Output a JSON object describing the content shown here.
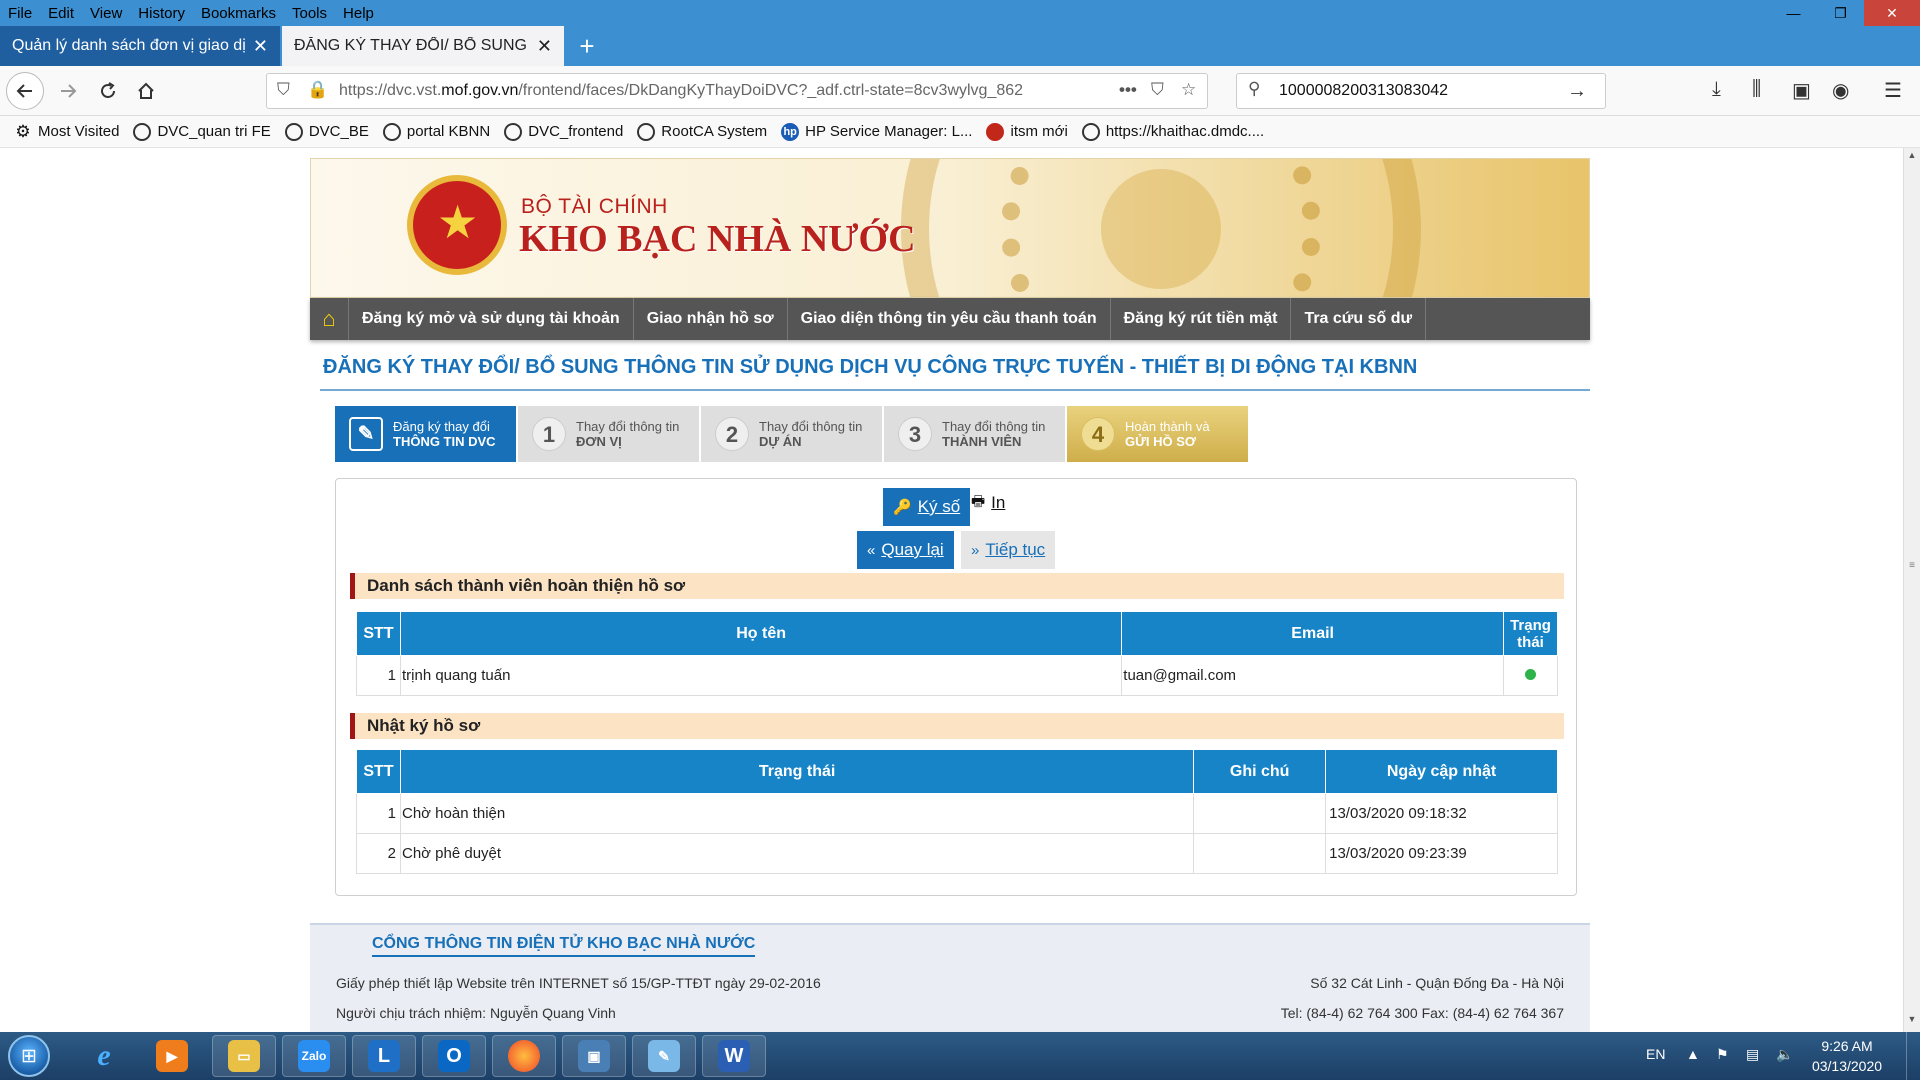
{
  "browser": {
    "menu": [
      "File",
      "Edit",
      "View",
      "History",
      "Bookmarks",
      "Tools",
      "Help"
    ],
    "window_buttons": {
      "minimize": "—",
      "restore": "❐",
      "close": "✕"
    },
    "tabs": [
      {
        "label": "Quản lý danh sách đơn vị giao dịch",
        "close": "✕"
      },
      {
        "label": "ĐĂNG KÝ THAY ĐỔI/ BỔ SUNG DỊCH",
        "close": "✕"
      }
    ],
    "new_tab": "+",
    "url_prefix": "https://dvc.vst.",
    "url_domain": "mof.gov.vn",
    "url_suffix": "/frontend/faces/DkDangKyThayDoiDVC?_adf.ctrl-state=8cv3wylvg_862",
    "url_more": "•••",
    "search_value": "1000008200313083042",
    "search_go": "→",
    "bookmarks": [
      {
        "label": "Most Visited",
        "icon": "gear-icon"
      },
      {
        "label": "DVC_quan tri FE",
        "icon": "globe-icon"
      },
      {
        "label": "DVC_BE",
        "icon": "globe-icon"
      },
      {
        "label": "portal KBNN",
        "icon": "globe-icon"
      },
      {
        "label": "DVC_frontend",
        "icon": "globe-icon"
      },
      {
        "label": "RootCA System",
        "icon": "globe-icon"
      },
      {
        "label": "HP Service Manager: L...",
        "icon": "hp-icon"
      },
      {
        "label": "itsm mới",
        "icon": "itsm-icon"
      },
      {
        "label": "https://khaithac.dmdc....",
        "icon": "globe-icon"
      }
    ]
  },
  "site": {
    "banner_sub": "BỘ TÀI CHÍNH",
    "banner_title": "KHO BẠC NHÀ NƯỚC",
    "nav_items": [
      "Đăng ký mở và sử dụng tài khoản",
      "Giao nhận hồ sơ",
      "Giao diện thông tin yêu cầu thanh toán",
      "Đăng ký rút tiền mặt",
      "Tra cứu số dư"
    ],
    "page_title": "ĐĂNG KÝ THAY ĐỔI/ BỔ SUNG THÔNG TIN SỬ DỤNG DỊCH VỤ CÔNG TRỰC TUYẾN - THIẾT BỊ DI ĐỘNG TẠI KBNN",
    "steps": [
      {
        "num": "",
        "line1": "Đăng ký thay đổi",
        "line2": "THÔNG TIN DVC"
      },
      {
        "num": "1",
        "line1": "Thay đổi thông tin",
        "line2": "ĐƠN VỊ"
      },
      {
        "num": "2",
        "line1": "Thay đổi thông tin",
        "line2": "DỰ ÁN"
      },
      {
        "num": "3",
        "line1": "Thay đổi thông tin",
        "line2": "THÀNH VIÊN"
      },
      {
        "num": "4",
        "line1": "Hoàn thành và",
        "line2": "GỬI HỒ SƠ"
      }
    ],
    "buttons": {
      "sign": "Ký số",
      "print": "In",
      "back": "Quay lại",
      "next": "Tiếp tục"
    },
    "members_section": "Danh sách thành viên hoàn thiện hồ sơ",
    "members_headers": [
      "STT",
      "Họ tên",
      "Email",
      "Trạng thái"
    ],
    "members_rows": [
      {
        "stt": "1",
        "name": "trịnh quang tuấn",
        "email": "tuan@gmail.com",
        "status": "active"
      }
    ],
    "log_section": "Nhật ký hồ sơ",
    "log_headers": [
      "STT",
      "Trạng thái",
      "Ghi chú",
      "Ngày cập nhật"
    ],
    "log_rows": [
      {
        "stt": "1",
        "status": "Chờ hoàn thiện",
        "note": "",
        "date": "13/03/2020 09:18:32"
      },
      {
        "stt": "2",
        "status": "Chờ phê duyệt",
        "note": "",
        "date": "13/03/2020 09:23:39"
      }
    ],
    "footer": {
      "title": "CỔNG THÔNG TIN ĐIỆN TỬ KHO BẠC NHÀ NƯỚC",
      "license": "Giấy phép thiết lập Website trên INTERNET số 15/GP-TTĐT ngày 29-02-2016",
      "responsible": "Người chịu trách nhiệm: Nguyễn Quang Vinh",
      "address": "Số 32 Cát Linh - Quận Đống Đa - Hà Nội",
      "phone": "Tel: (84-4) 62 764 300 Fax: (84-4) 62 764 367"
    }
  },
  "taskbar": {
    "apps": [
      "ie",
      "media",
      "explorer",
      "Zalo",
      "Lync",
      "Outlook",
      "Firefox",
      "network",
      "paint",
      "Word"
    ],
    "lang": "EN",
    "time": "9:26 AM",
    "date": "03/13/2020"
  },
  "colors": {
    "accent": "#1770b8",
    "header_table": "#1784c7",
    "section_bg": "#fbe3c4",
    "section_bar": "#a01616",
    "banner_red": "#b9211d"
  }
}
